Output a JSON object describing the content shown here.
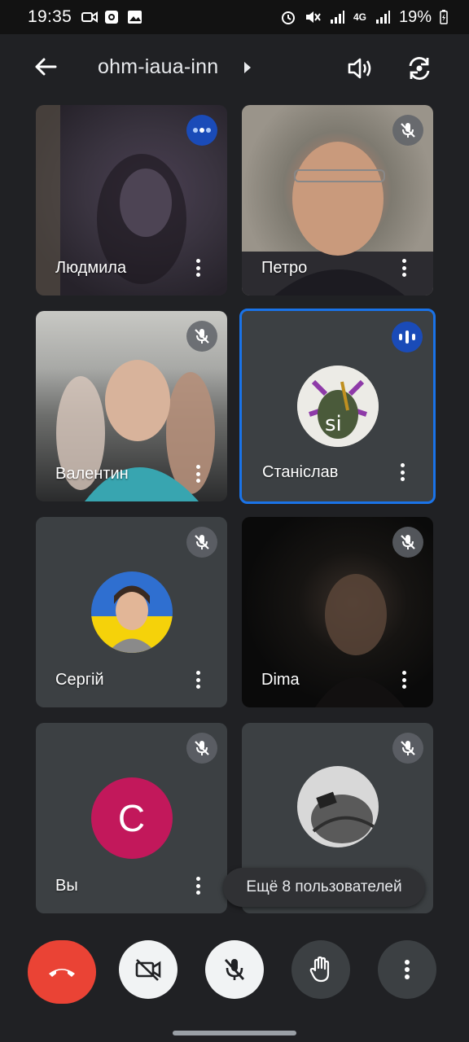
{
  "status_bar": {
    "time": "19:35",
    "battery": "19%",
    "signal_1": "4G",
    "left_icons": [
      "video-icon",
      "media-icon",
      "image-icon"
    ],
    "right_icons": [
      "alarm-icon",
      "mute-icon",
      "signal-icon",
      "data-icon",
      "battery-icon"
    ]
  },
  "header": {
    "title": "ohm-iaua-inn",
    "icons": [
      "back-arrow-icon",
      "chevron-right-icon",
      "speaker-icon",
      "switch-camera-icon"
    ]
  },
  "participants": [
    {
      "name": "Людмила",
      "mic": "speaking-dots",
      "kind": "video"
    },
    {
      "name": "Петро",
      "mic": "muted",
      "kind": "video"
    },
    {
      "name": "Валентин",
      "mic": "muted",
      "kind": "video"
    },
    {
      "name": "Станіслав",
      "mic": "speaking",
      "kind": "avatar",
      "avatar_text": "si",
      "active": true
    },
    {
      "name": "Сергій",
      "mic": "muted",
      "kind": "avatar"
    },
    {
      "name": "Dima",
      "mic": "muted",
      "kind": "video"
    },
    {
      "name": "Вы",
      "mic": "muted",
      "kind": "letter",
      "avatar_letter": "C"
    },
    {
      "name": "",
      "mic": "muted",
      "kind": "avatar"
    }
  ],
  "toast": {
    "text": "Ещё 8 пользователей"
  },
  "controls": {
    "icons": [
      "end-call-icon",
      "camera-off-icon",
      "mic-off-icon",
      "raise-hand-icon",
      "more-vert-icon"
    ]
  },
  "colors": {
    "background": "#202124",
    "tile": "#3c4043",
    "active_border": "#1a73e8",
    "end_call": "#ea4335",
    "avatar_letter_bg": "#c2185b"
  }
}
